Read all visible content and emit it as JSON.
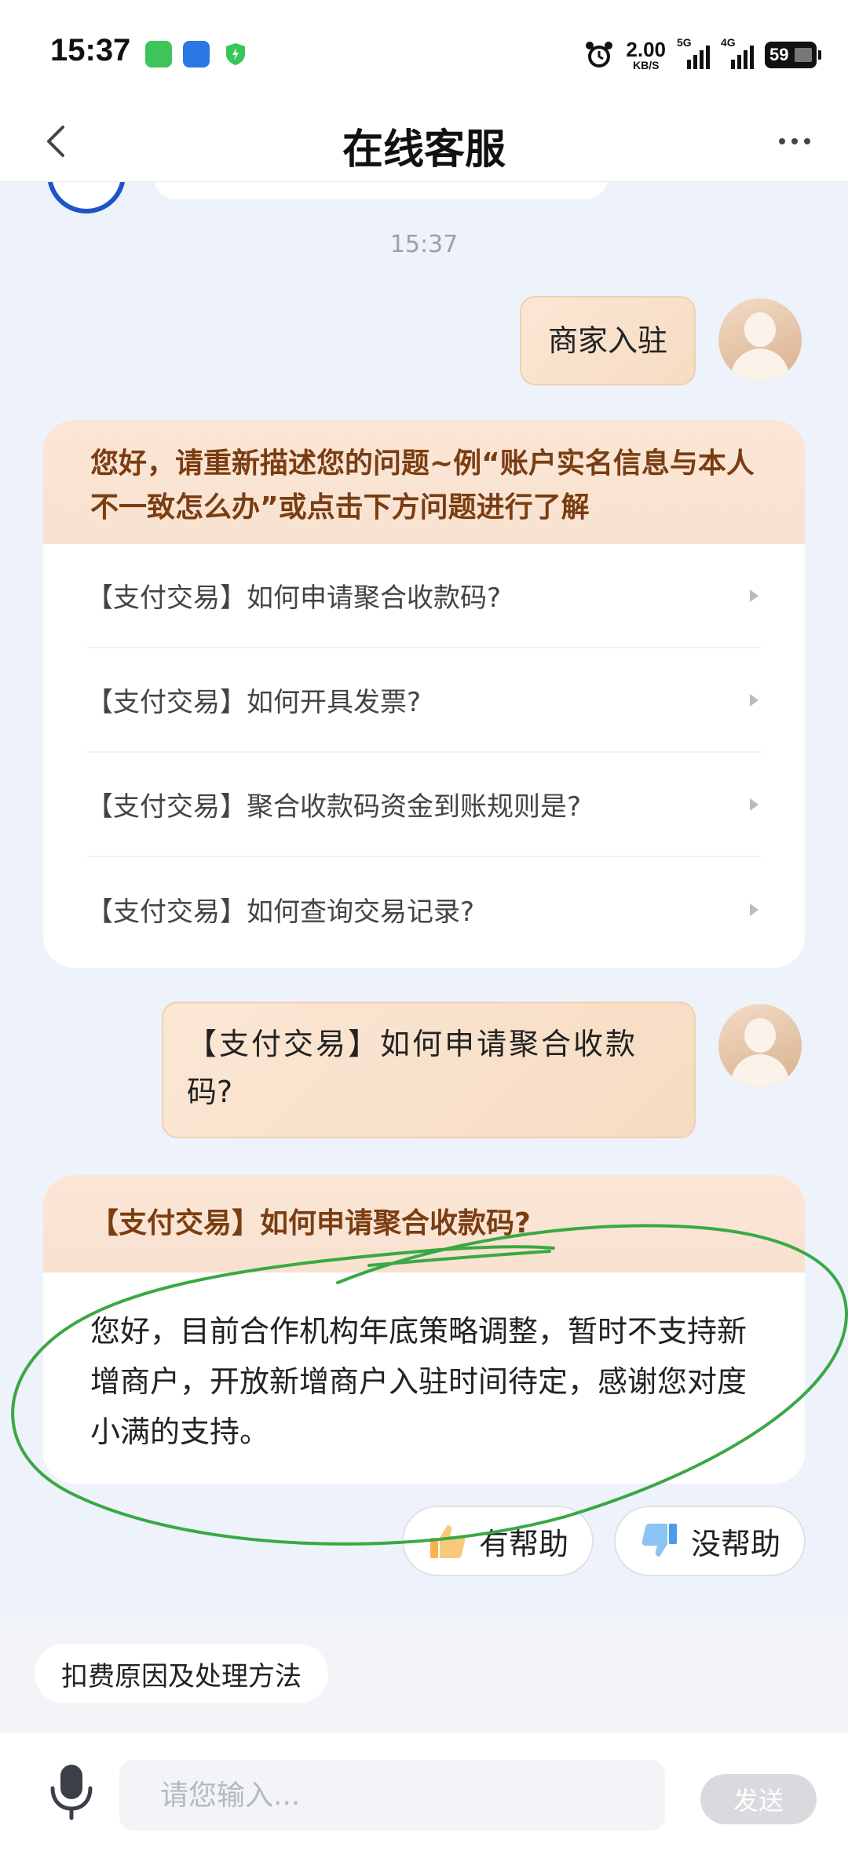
{
  "status_bar": {
    "time": "15:37",
    "net_speed_value": "2.00",
    "net_speed_unit": "KB/S",
    "signal1_tag": "5G",
    "signal2_tag": "4G",
    "battery": "59"
  },
  "header": {
    "title": "在线客服"
  },
  "chat": {
    "timestamp": "15:37",
    "user_msg1": "商家入驻",
    "faq_card": {
      "intro": "您好，请重新描述您的问题~例“账户实名信息与本人不一致怎么办”或点击下方问题进行了解",
      "items": [
        {
          "label": "【支付交易】如何申请聚合收款码?"
        },
        {
          "label": "【支付交易】如何开具发票?"
        },
        {
          "label": "【支付交易】聚合收款码资金到账规则是?"
        },
        {
          "label": "【支付交易】如何查询交易记录?"
        }
      ]
    },
    "user_msg2_line1": "【支付交易】如何申请聚合收款",
    "user_msg2_line2": "码?",
    "answer_card": {
      "title": "【支付交易】如何申请聚合收款码?",
      "body": "您好，目前合作机构年底策略调整，暂时不支持新增商户，开放新增商户入驻时间待定，感谢您对度小满的支持。"
    },
    "feedback": {
      "helpful_label": "有帮助",
      "unhelpful_label": "没帮助"
    }
  },
  "quick_bar": {
    "chip_label": "扣费原因及处理方法"
  },
  "input_bar": {
    "placeholder": "请您输入...",
    "send_label": "发送"
  },
  "colors": {
    "accent_text": "#7a3d12",
    "card_header_bg": "#fbe6d6",
    "user_bubble_bg": "#f8e0c9",
    "annotation_green": "#3aa844"
  }
}
